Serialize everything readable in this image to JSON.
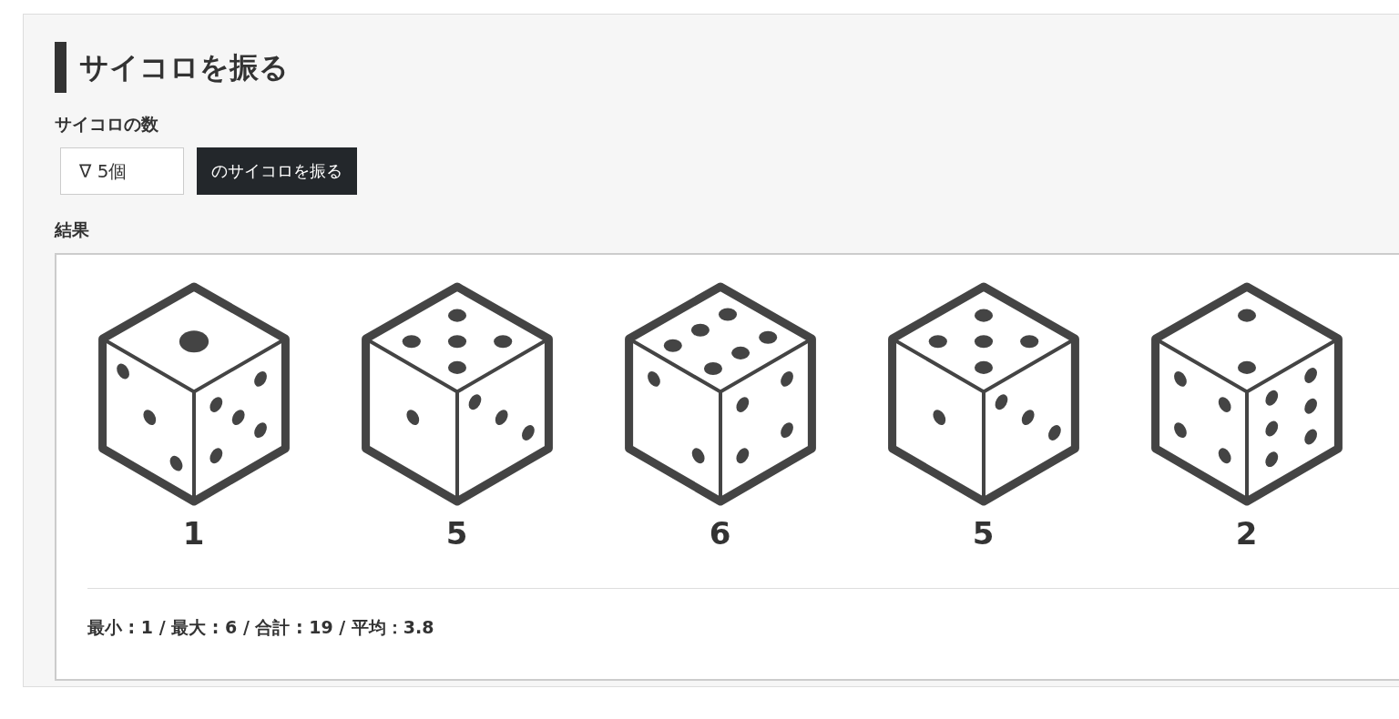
{
  "title": "サイコロを振る",
  "count_label": "サイコロの数",
  "count_select": {
    "value": "∇ 5個"
  },
  "roll_button": "のサイコロを振る",
  "result_label": "結果",
  "dice": [
    {
      "value": "1"
    },
    {
      "value": "5"
    },
    {
      "value": "6"
    },
    {
      "value": "5"
    },
    {
      "value": "2"
    }
  ],
  "stats": "最小 : 1 / 最大 : 6 / 合計 : 19 / 平均：3.8"
}
